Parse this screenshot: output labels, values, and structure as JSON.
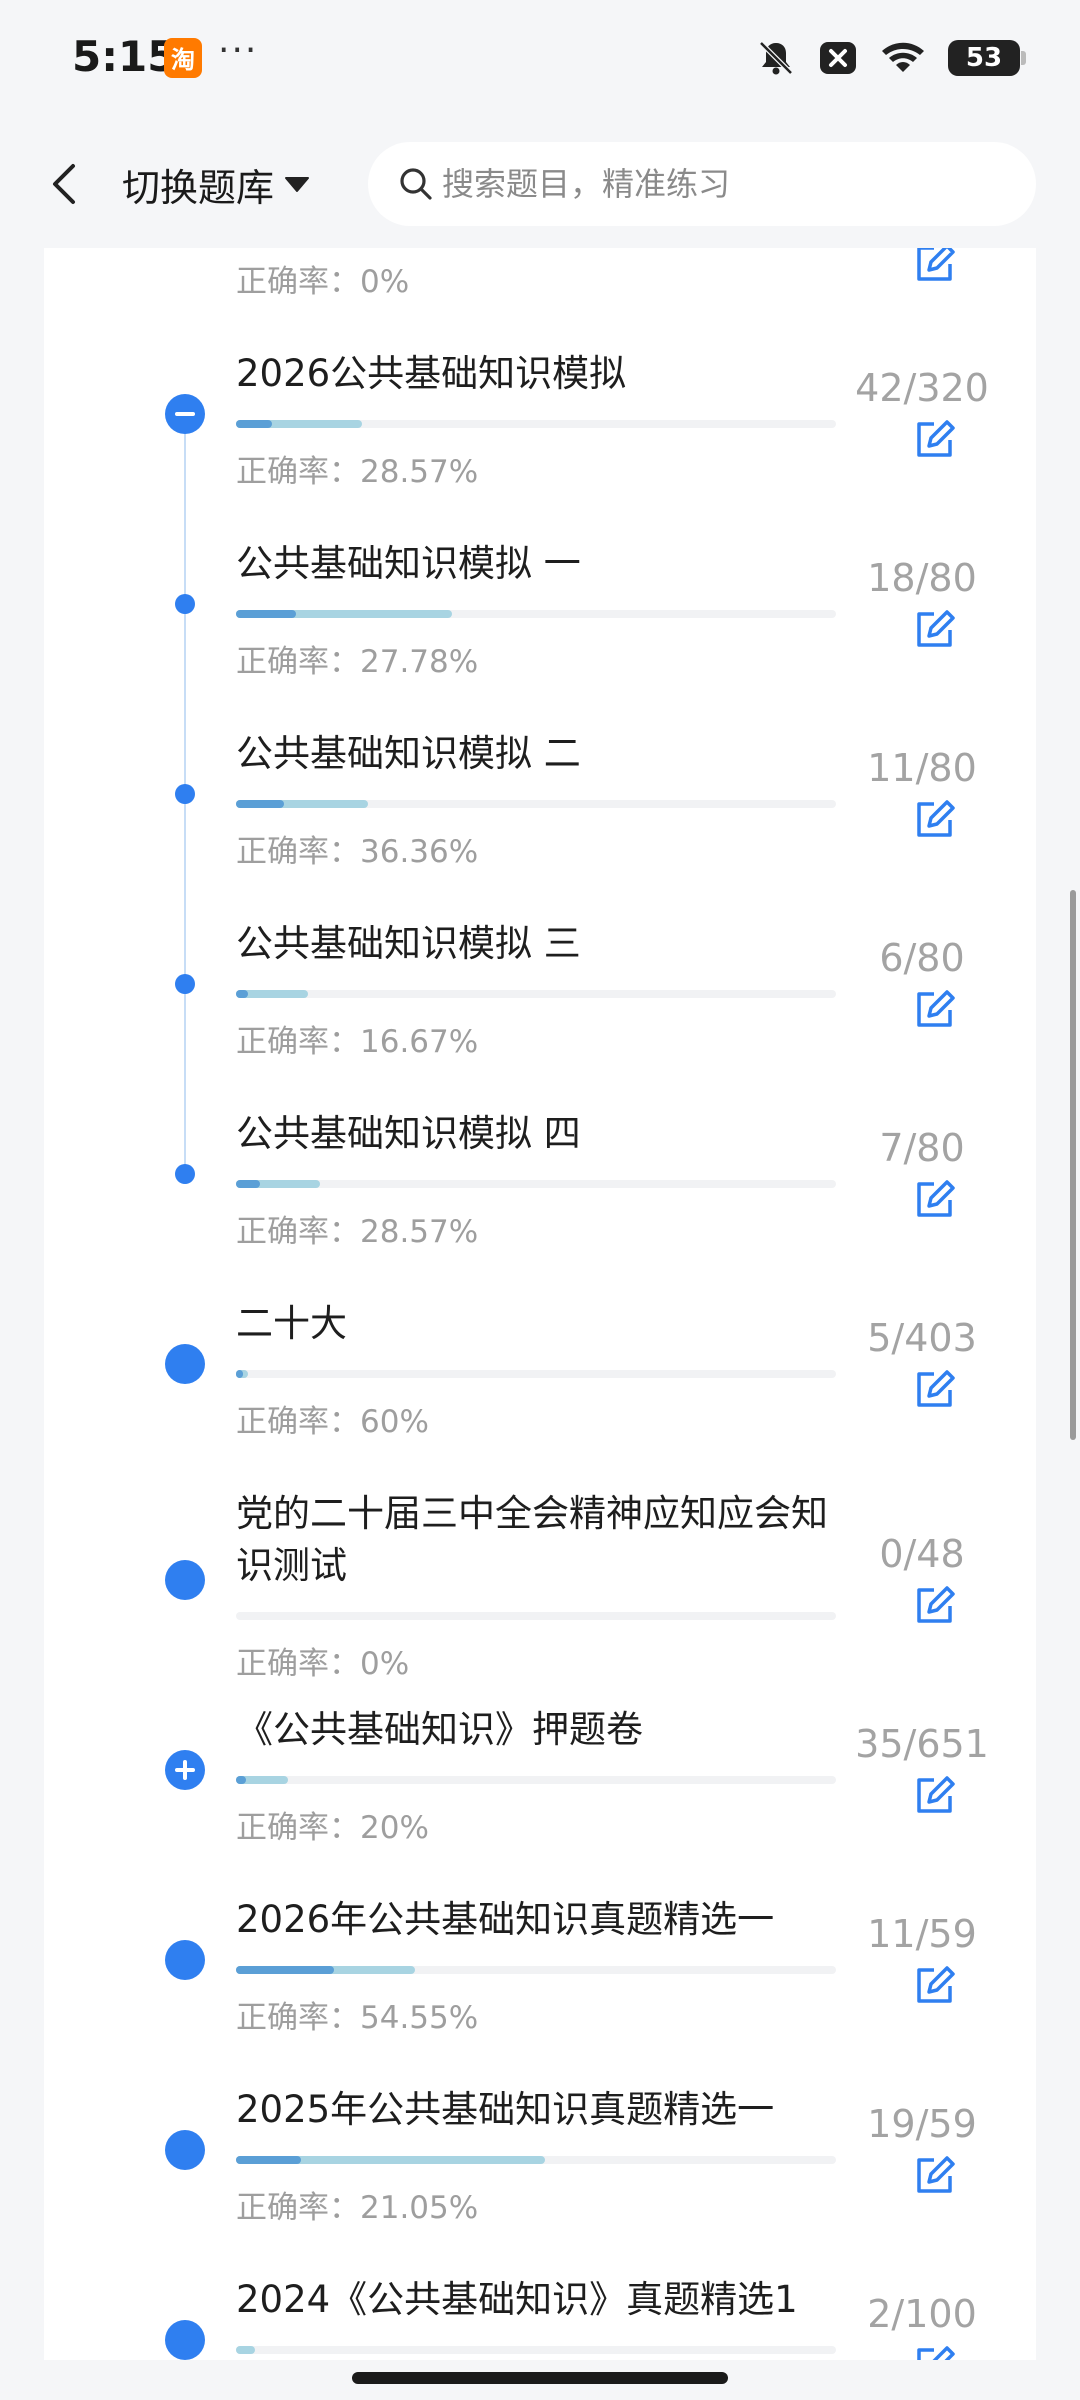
{
  "status_bar": {
    "time": "5:15",
    "app_badge": "淘",
    "dots": "···",
    "battery": "53"
  },
  "header": {
    "switch_label": "切换题库",
    "search_placeholder": "搜索题目，精准练习"
  },
  "accuracy_prefix": "正确率：",
  "partial_top": {
    "accuracy": "0%"
  },
  "items": [
    {
      "title": "2026公共基础知识模拟",
      "done": 42,
      "total": 320,
      "count": "42/320",
      "accuracy": "28.57%",
      "node": "collapse"
    },
    {
      "title": "公共基础知识模拟 一",
      "done": 18,
      "total": 80,
      "count": "18/80",
      "accuracy": "27.78%",
      "node": "small"
    },
    {
      "title": "公共基础知识模拟 二",
      "done": 11,
      "total": 80,
      "count": "11/80",
      "accuracy": "36.36%",
      "node": "small"
    },
    {
      "title": "公共基础知识模拟 三",
      "done": 6,
      "total": 80,
      "count": "6/80",
      "accuracy": "16.67%",
      "node": "small"
    },
    {
      "title": "公共基础知识模拟 四",
      "done": 7,
      "total": 80,
      "count": "7/80",
      "accuracy": "28.57%",
      "node": "small"
    },
    {
      "title": "二十大",
      "done": 5,
      "total": 403,
      "count": "5/403",
      "accuracy": "60%",
      "node": "dot"
    },
    {
      "title": "党的二十届三中全会精神应知应会知识测试",
      "done": 0,
      "total": 48,
      "count": "0/48",
      "accuracy": "0%",
      "node": "dot"
    },
    {
      "title": "《公共基础知识》押题卷",
      "done": 35,
      "total": 651,
      "count": "35/651",
      "accuracy": "20%",
      "node": "expand"
    },
    {
      "title": "2026年公共基础知识真题精选一",
      "done": 11,
      "total": 59,
      "count": "11/59",
      "accuracy": "54.55%",
      "node": "dot"
    },
    {
      "title": "2025年公共基础知识真题精选一",
      "done": 19,
      "total": 59,
      "count": "19/59",
      "accuracy": "21.05%",
      "node": "dot"
    },
    {
      "title": "2024《公共基础知识》真题精选1",
      "done": 2,
      "total": 100,
      "count": "2/100",
      "accuracy": "",
      "node": "dot"
    }
  ]
}
